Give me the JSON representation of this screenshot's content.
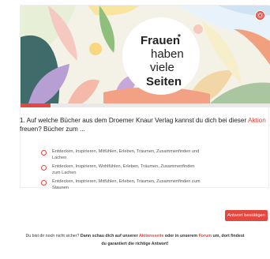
{
  "banner": {
    "logo_line1": "Frauen",
    "logo_star": "*",
    "logo_line2": "haben",
    "logo_line3": "viele",
    "logo_line4": "Seiten",
    "settings_icon": "gear-icon"
  },
  "progress": {
    "fraction": 0.12
  },
  "question": {
    "text_before": "1. Auf welche Bücher aus dem Droemer Knaur Verlag kannst du dich bei dieser ",
    "accent": "Aktion",
    "text_after": " freuen? Bücher zum ..."
  },
  "options": [
    {
      "label": "Entdecken, Inspirieren, Mitfühlen, Erleben, Träumen, Zusammenfinden und Lachen"
    },
    {
      "label": "Entdecken, Inspirieren, Wohlfühlen, Erleben, Träumen, Zusammenfinden zum Lachen"
    },
    {
      "label": "Entdecken, Inspirieren, Mitfühlen, Erleben, Träumen, Zusammenfinden zum Staunen"
    }
  ],
  "submit_label": "Antwort bestätigen",
  "footer": {
    "part1": "Du bist dir noch nicht sicher? ",
    "part2": "Dann schau dich auf unserer ",
    "link1": "Aktionsseite",
    "part3": "  oder in unserem ",
    "link2": "Forum",
    "part4": " um, dort findest",
    "line2": "du garantiert die richtige Antwort!"
  },
  "colors": {
    "accent": "#e3473f"
  }
}
